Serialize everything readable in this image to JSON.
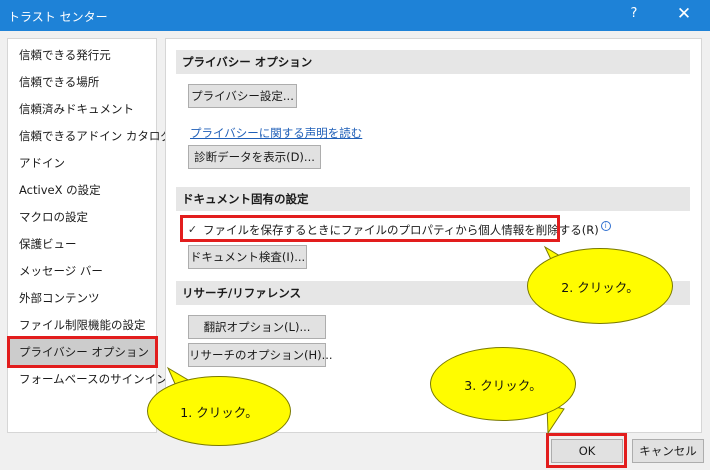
{
  "window": {
    "title": "トラスト センター",
    "help": "?",
    "close": "✕"
  },
  "sidebar": {
    "items": [
      {
        "label": "信頼できる発行元"
      },
      {
        "label": "信頼できる場所"
      },
      {
        "label": "信頼済みドキュメント"
      },
      {
        "label": "信頼できるアドイン カタログ"
      },
      {
        "label": "アドイン"
      },
      {
        "label": "ActiveX の設定"
      },
      {
        "label": "マクロの設定"
      },
      {
        "label": "保護ビュー"
      },
      {
        "label": "メッセージ バー"
      },
      {
        "label": "外部コンテンツ"
      },
      {
        "label": "ファイル制限機能の設定"
      },
      {
        "label": "プライバシー オプション"
      },
      {
        "label": "フォームベースのサインイン"
      }
    ],
    "selected": "プライバシー オプション"
  },
  "privacy": {
    "header": "プライバシー オプション",
    "settings_button": "プライバシー設定...",
    "statement_link": "プライバシーに関する声明を読む",
    "diagnostic_button": "診断データを表示(D)..."
  },
  "document": {
    "header": "ドキュメント固有の設定",
    "remove_personal_info_label": "ファイルを保存するときにファイルのプロパティから個人情報を削除する(R)",
    "remove_personal_info_checked": true,
    "inspect_button": "ドキュメント検査(I)..."
  },
  "research": {
    "header": "リサーチ/リファレンス",
    "translation_button": "翻訳オプション(L)...",
    "research_button": "リサーチのオプション(H)..."
  },
  "footer": {
    "ok_label": "OK",
    "cancel_label": "キャンセル"
  },
  "callouts": {
    "step1": "1. クリック。",
    "step2": "2. クリック。",
    "step3": "3. クリック。"
  },
  "colors": {
    "titlebar": "#1e82d7",
    "highlight": "#e21d1d",
    "callout": "#fffc00",
    "link": "#1f5fb8"
  },
  "icons": {
    "check": "✓",
    "info": "i"
  }
}
